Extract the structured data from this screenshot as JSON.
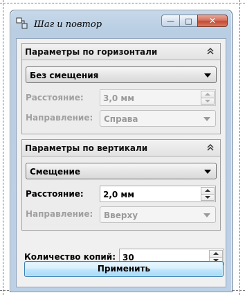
{
  "window": {
    "title": "Шаг и повтор",
    "minimize_glyph": "—",
    "maximize_glyph": "□",
    "close_glyph": "✕"
  },
  "horizontal": {
    "header": "Параметры по горизонтали",
    "mode_value": "Без смещения",
    "distance_label": "Расстояние:",
    "distance_value": "3,0 мм",
    "direction_label": "Направление:",
    "direction_value": "Справа",
    "enabled": false
  },
  "vertical": {
    "header": "Параметры по вертикали",
    "mode_value": "Смещение",
    "distance_label": "Расстояние:",
    "distance_value": "2,0 мм",
    "direction_label": "Направление:",
    "direction_value": "Вверху",
    "enabled": true
  },
  "copies": {
    "label": "Количество копий:",
    "value": "30"
  },
  "apply_label": "Применить",
  "icons": {
    "app": "step-repeat-icon",
    "collapse": "double-chevron-up-icon",
    "combo_arrow": "dropdown-arrow-icon"
  },
  "colors": {
    "window_frame": "#bdd1e6",
    "close_button": "#c34a33",
    "apply_button": "#bee6fd",
    "disabled_text": "#a0a0a0"
  }
}
